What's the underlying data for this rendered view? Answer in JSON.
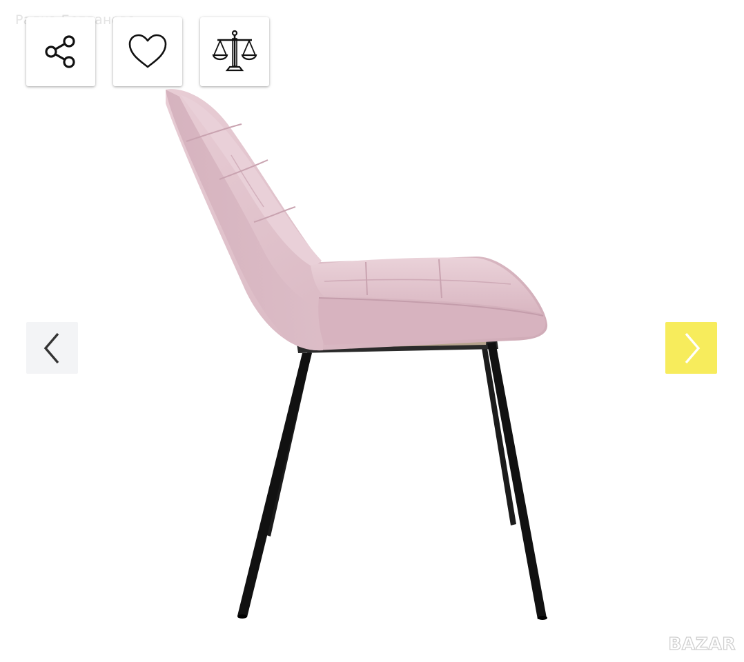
{
  "seller": {
    "name": "Радка Богданова"
  },
  "actions": {
    "share_icon": "share-icon",
    "favorite_icon": "heart-icon",
    "compare_icon": "scales-icon"
  },
  "gallery": {
    "prev_icon": "chevron-left-icon",
    "next_icon": "chevron-right-icon",
    "image_subject": "pink velvet upholstered dining chair with black metal legs, side view"
  },
  "brand": {
    "logo_text": "BAZAR"
  },
  "colors": {
    "next_button_bg": "#f7ec5c",
    "prev_button_bg": "#f3f4f6",
    "chair_fabric": "#e2c3cd",
    "chair_legs": "#151515"
  }
}
